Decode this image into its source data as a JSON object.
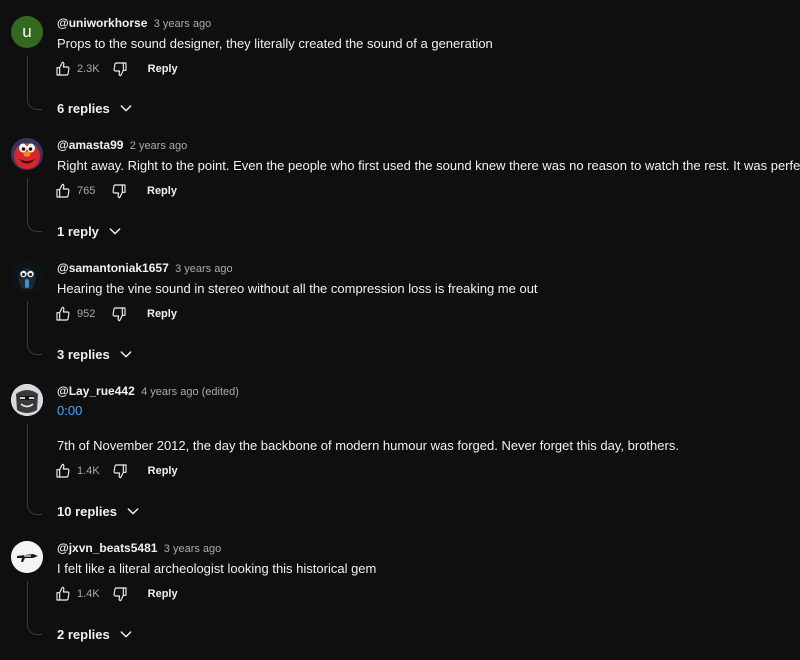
{
  "comments": [
    {
      "author": "@uniworkhorse",
      "time": "3 years ago",
      "avatar_letter": "u",
      "text": "Props to the sound designer, they literally created the sound of a generation",
      "likes": "2.3K",
      "reply_label": "Reply",
      "replies_label": "6 replies"
    },
    {
      "author": "@amasta99",
      "time": "2 years ago",
      "text": "Right away. Right to the point. Even the people who first used the sound knew there was no reason to watch the rest. It was perfect.",
      "likes": "765",
      "reply_label": "Reply",
      "replies_label": "1 reply"
    },
    {
      "author": "@samantoniak1657",
      "time": "3 years ago",
      "text": "Hearing the vine sound in stereo without all the compression loss is freaking me out",
      "likes": "952",
      "reply_label": "Reply",
      "replies_label": "3 replies"
    },
    {
      "author": "@Lay_rue442",
      "time": "4 years ago (edited)",
      "timestamp_link": "0:00",
      "text": "7th of November 2012, the day the backbone of modern humour was forged. Never forget this day, brothers.",
      "likes": "1.4K",
      "reply_label": "Reply",
      "replies_label": "10 replies"
    },
    {
      "author": "@jxvn_beats5481",
      "time": "3 years ago",
      "text": "I felt like a literal archeologist looking this historical gem",
      "likes": "1.4K",
      "reply_label": "Reply",
      "replies_label": "2 replies"
    }
  ],
  "icons": {
    "like": "thumb-up-icon",
    "dislike": "thumb-down-icon",
    "expand": "chevron-down-icon"
  },
  "colors": {
    "background": "#0f0f0f",
    "text": "#f1f1f1",
    "secondary": "#aaaaaa",
    "link": "#3ea6ff",
    "avatar_u": "#33691e"
  }
}
